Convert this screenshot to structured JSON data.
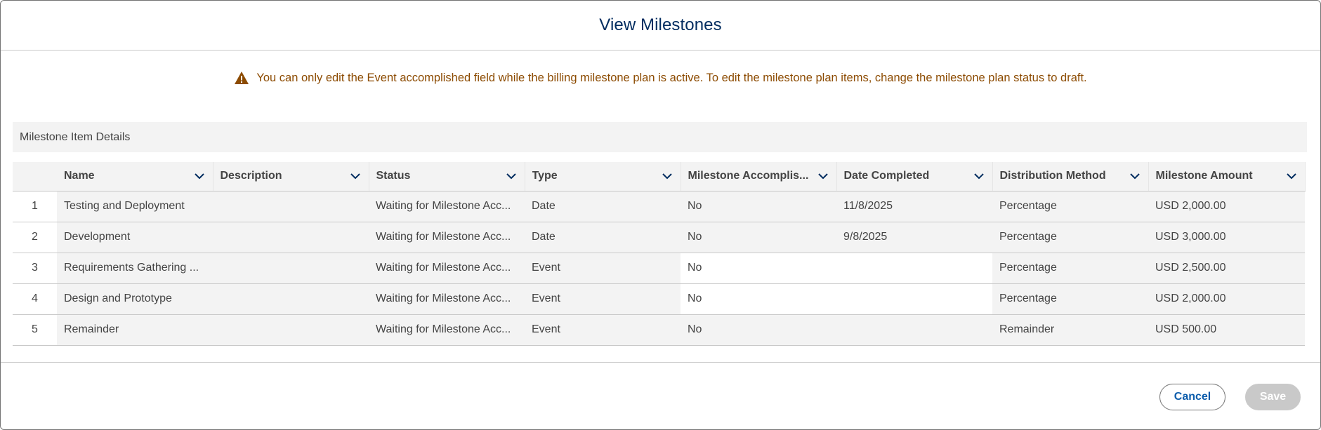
{
  "modal": {
    "title": "View Milestones",
    "warning": "You can only edit the Event accomplished field while the billing milestone plan is active. To edit the milestone plan items, change the milestone plan status to draft.",
    "section_title": "Milestone Item Details"
  },
  "table": {
    "columns": [
      {
        "label": "Name"
      },
      {
        "label": "Description"
      },
      {
        "label": "Status"
      },
      {
        "label": "Type"
      },
      {
        "label": "Milestone Accomplis..."
      },
      {
        "label": "Date Completed"
      },
      {
        "label": "Distribution Method"
      },
      {
        "label": "Milestone Amount"
      }
    ],
    "rows": [
      {
        "num": "1",
        "name": "Testing and Deployment",
        "description": "",
        "status": "Waiting for Milestone Acc...",
        "type": "Date",
        "accomplished": "No",
        "date_completed": "11/8/2025",
        "distribution": "Percentage",
        "amount": "USD 2,000.00"
      },
      {
        "num": "2",
        "name": "Development",
        "description": "",
        "status": "Waiting for Milestone Acc...",
        "type": "Date",
        "accomplished": "No",
        "date_completed": "9/8/2025",
        "distribution": "Percentage",
        "amount": "USD 3,000.00"
      },
      {
        "num": "3",
        "name": "Requirements Gathering ...",
        "description": "",
        "status": "Waiting for Milestone Acc...",
        "type": "Event",
        "accomplished": "No",
        "date_completed": "",
        "distribution": "Percentage",
        "amount": "USD 2,500.00"
      },
      {
        "num": "4",
        "name": "Design and Prototype",
        "description": "",
        "status": "Waiting for Milestone Acc...",
        "type": "Event",
        "accomplished": "No",
        "date_completed": "",
        "distribution": "Percentage",
        "amount": "USD 2,000.00"
      },
      {
        "num": "5",
        "name": "Remainder",
        "description": "",
        "status": "Waiting for Milestone Acc...",
        "type": "Event",
        "accomplished": "No",
        "date_completed": "",
        "distribution": "Remainder",
        "amount": "USD 500.00"
      }
    ]
  },
  "footer": {
    "cancel_label": "Cancel",
    "save_label": "Save"
  },
  "colors": {
    "title": "#032d60",
    "warning": "#8c4b02",
    "cancel_text": "#0b5cab",
    "save_disabled": "#c9c9c9"
  },
  "icons": {
    "warning": "warning-icon",
    "column_menu": "chevron-down-icon"
  }
}
